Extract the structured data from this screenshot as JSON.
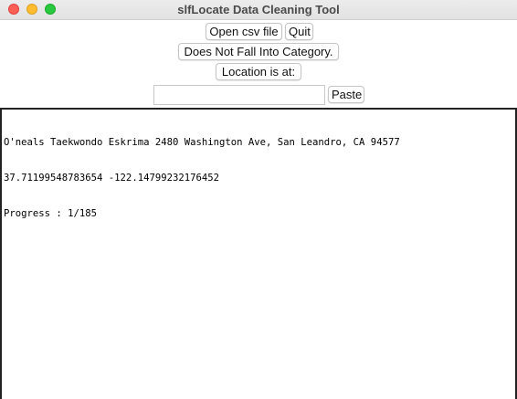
{
  "window": {
    "title": "slfLocate Data Cleaning Tool"
  },
  "controls": {
    "open_csv_label": "Open csv file",
    "quit_label": "Quit",
    "not_in_category_label": "Does Not Fall Into Category.",
    "location_label": "Location is at:",
    "location_value": "",
    "paste_label": "Paste"
  },
  "output": {
    "lines": [
      "O'neals Taekwondo Eskrima 2480 Washington Ave, San Leandro, CA 94577",
      "37.71199548783654 -122.14799232176452",
      "Progress : 1/185"
    ]
  }
}
